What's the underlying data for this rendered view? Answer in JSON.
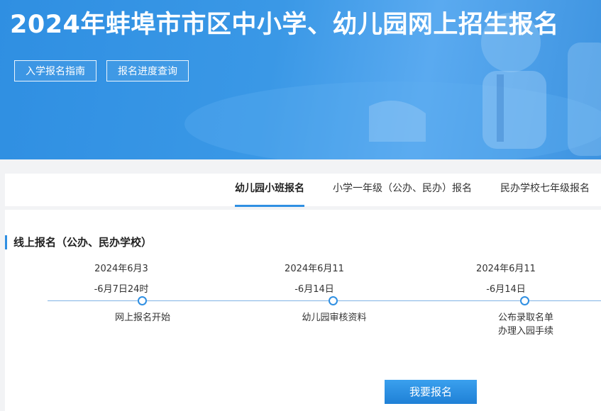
{
  "hero": {
    "title": "2024年蚌埠市市区中小学、幼儿园网上招生报名",
    "buttons": [
      "入学报名指南",
      "报名进度查询"
    ]
  },
  "tabs": [
    {
      "label": "幼儿园小班报名",
      "active": true
    },
    {
      "label": "小学一年级（公办、民办）报名",
      "active": false
    },
    {
      "label": "民办学校七年级报名",
      "active": false
    }
  ],
  "section": {
    "title": "线上报名（公办、民办学校）"
  },
  "timeline": [
    {
      "date_line1": "2024年6月3",
      "date_line2": "-6月7日24时",
      "label": [
        "网上报名开始"
      ]
    },
    {
      "date_line1": "2024年6月11",
      "date_line2": "-6月14日",
      "label": [
        "幼儿园审核资料"
      ]
    },
    {
      "date_line1": "2024年6月11",
      "date_line2": "-6月14日",
      "label": [
        "公布录取名单",
        "办理入园手续"
      ]
    }
  ],
  "action": {
    "signup_label": "我要报名"
  },
  "colors": {
    "accent": "#2f8fe2",
    "banner": "#3a98e6",
    "page_bg": "#f2f3f5"
  }
}
